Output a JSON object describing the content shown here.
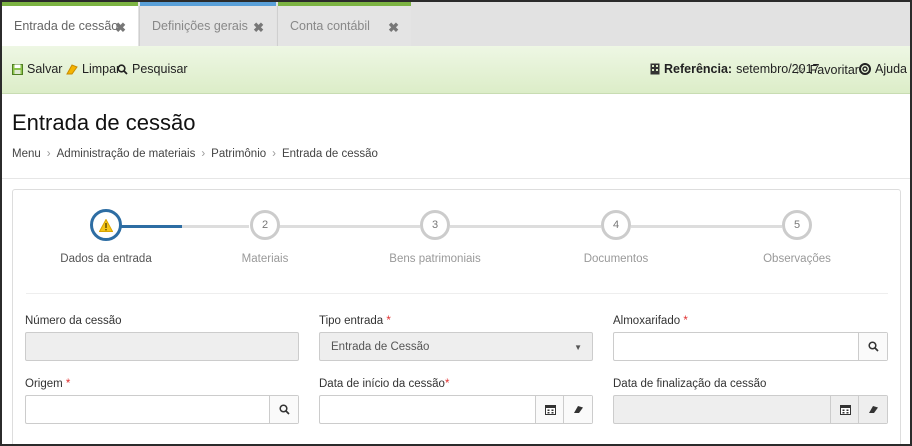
{
  "tabs": [
    {
      "label": "Entrada de cessão",
      "close": "✖"
    },
    {
      "label": "Definições gerais",
      "close": "✖"
    },
    {
      "label": "Conta contábil",
      "close": "✖"
    }
  ],
  "toolbar": {
    "save": "Salvar",
    "clear": "Limpar",
    "search": "Pesquisar",
    "reference_label": "Referência:",
    "reference_value": "setembro/2017",
    "favorite": "Favoritar",
    "help": "Ajuda"
  },
  "page": {
    "title": "Entrada de cessão",
    "breadcrumb": [
      "Menu",
      "Administração de materiais",
      "Patrimônio",
      "Entrada de cessão"
    ]
  },
  "steps": [
    {
      "num": "!",
      "label": "Dados da entrada",
      "state": "active"
    },
    {
      "num": "2",
      "label": "Materiais",
      "state": "pending"
    },
    {
      "num": "3",
      "label": "Bens patrimoniais",
      "state": "pending"
    },
    {
      "num": "4",
      "label": "Documentos",
      "state": "pending"
    },
    {
      "num": "5",
      "label": "Observações",
      "state": "pending"
    }
  ],
  "form": {
    "numero_cessao": {
      "label": "Número da cessão",
      "value": ""
    },
    "tipo_entrada": {
      "label": "Tipo entrada",
      "required": "*",
      "value": "Entrada de Cessão"
    },
    "almoxarifado": {
      "label": "Almoxarifado",
      "required": "*",
      "value": ""
    },
    "origem": {
      "label": "Origem",
      "required": "*",
      "value": ""
    },
    "data_inicio": {
      "label": "Data de início da cessão",
      "required": "*",
      "value": ""
    },
    "data_fim": {
      "label": "Data de finalização da cessão",
      "value": ""
    }
  },
  "colors": {
    "accent_green": "#7cb342",
    "accent_blue": "#5aa0d8",
    "step_active": "#2d6da3",
    "warning": "#f5c518",
    "required": "#e03131"
  }
}
